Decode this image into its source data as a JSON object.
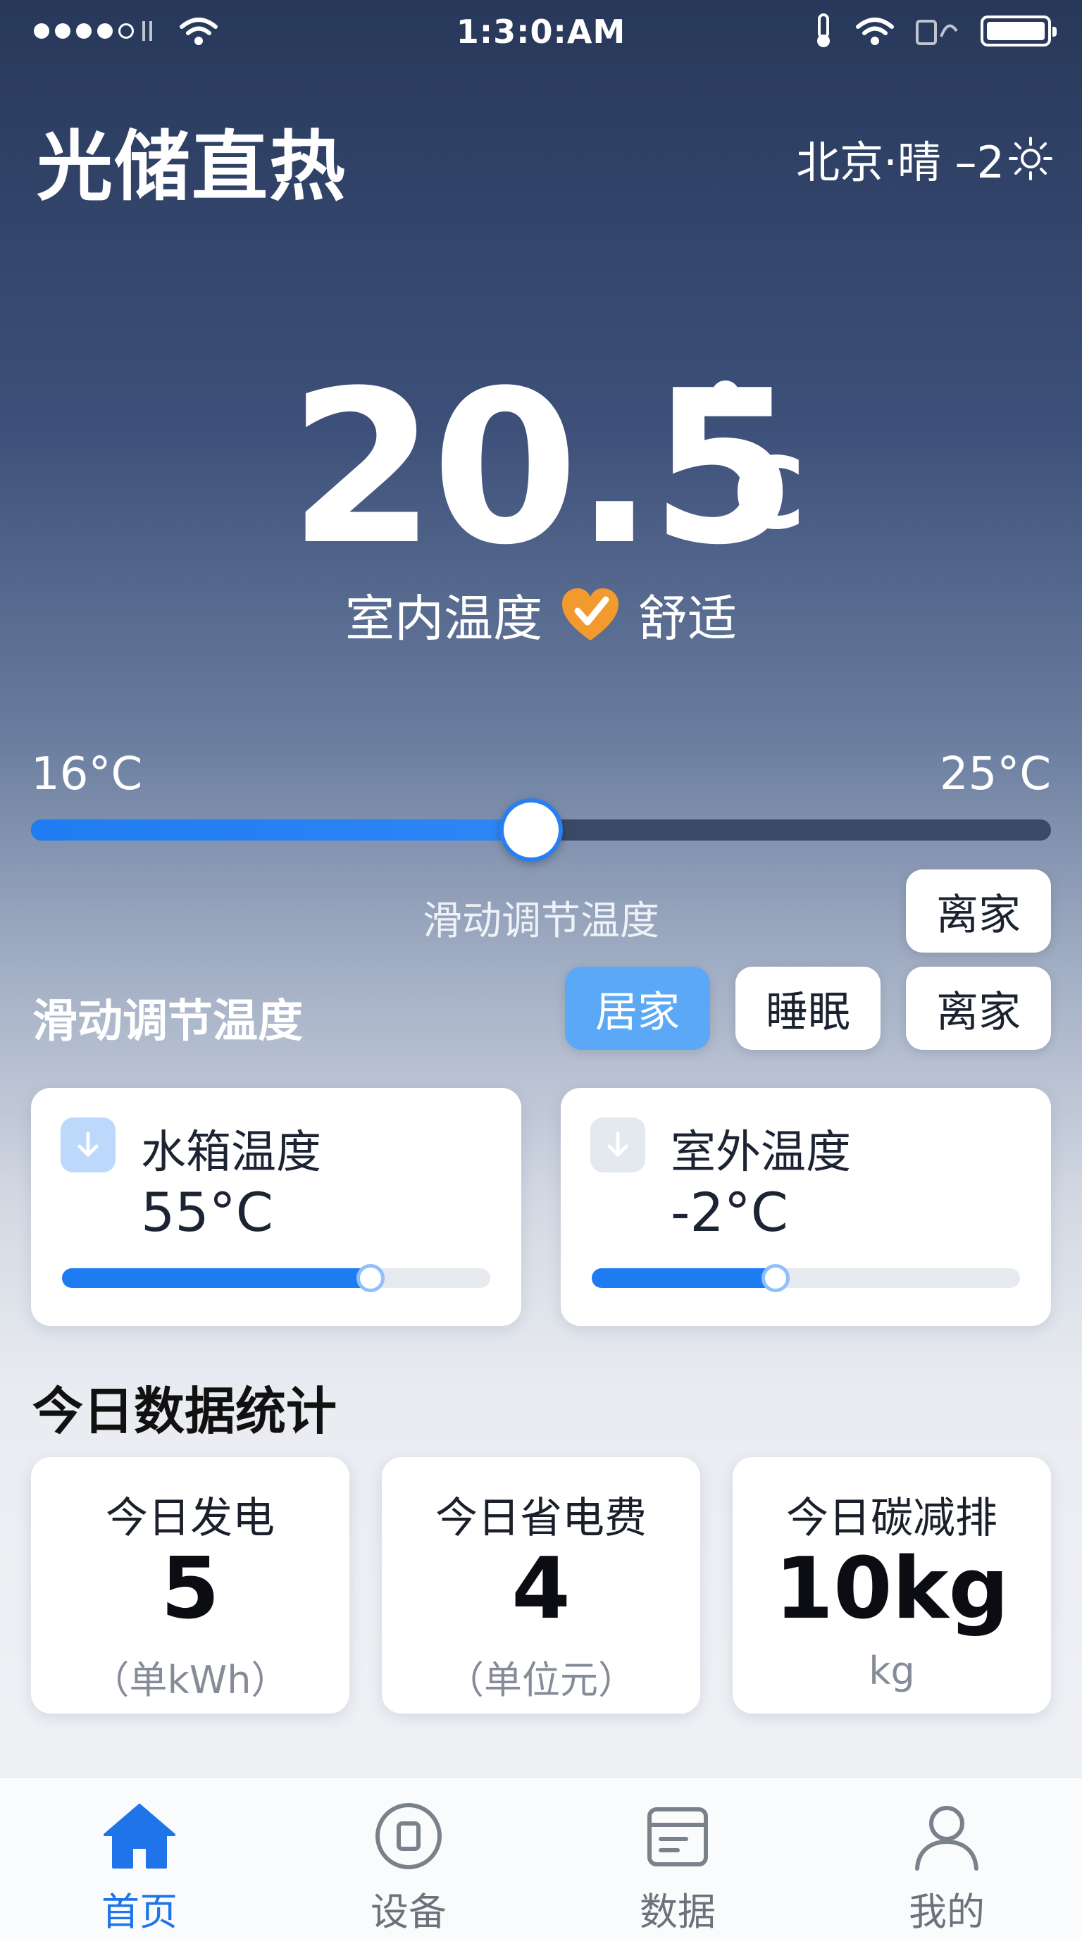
{
  "status_bar": {
    "time": "1:3:0:AM"
  },
  "header": {
    "title": "光储直热",
    "weather": "北京·晴 –2"
  },
  "indoor": {
    "temperature": "20.5",
    "degree_symbol": "°",
    "unit": "C",
    "label": "室内温度",
    "comfort": "舒适"
  },
  "temp_slider": {
    "min_label": "16°C",
    "max_label": "25°C",
    "value_fraction": 0.49,
    "hint": "滑动调节温度"
  },
  "mode_section": {
    "label": "滑动调节温度",
    "floating_chip": "离家",
    "modes": [
      {
        "label": "居家",
        "active": true
      },
      {
        "label": "睡眠",
        "active": false
      },
      {
        "label": "离家",
        "active": false
      }
    ]
  },
  "temp_cards": [
    {
      "title": "水箱温度",
      "value": "55°C",
      "fill_fraction": 0.72,
      "icon": "arrow-down-icon"
    },
    {
      "title": "室外温度",
      "value": "-2°C",
      "fill_fraction": 0.43,
      "icon": "arrow-down-icon"
    }
  ],
  "stats": {
    "title": "今日数据统计",
    "items": [
      {
        "label": "今日发电",
        "value": "5",
        "unit": "（单kWh）"
      },
      {
        "label": "今日省电费",
        "value": "4",
        "unit": "（单位元）"
      },
      {
        "label": "今日碳减排",
        "value": "10kg",
        "unit": "kg"
      }
    ]
  },
  "tabbar": {
    "tabs": [
      {
        "label": "首页",
        "icon": "home-icon",
        "active": true
      },
      {
        "label": "设备",
        "icon": "device-icon",
        "active": false
      },
      {
        "label": "数据",
        "icon": "data-icon",
        "active": false
      },
      {
        "label": "我的",
        "icon": "profile-icon",
        "active": false
      }
    ]
  },
  "colors": {
    "accent": "#1f7cf2",
    "chip_active": "#5aa8f6",
    "heart": "#f29a2e"
  }
}
